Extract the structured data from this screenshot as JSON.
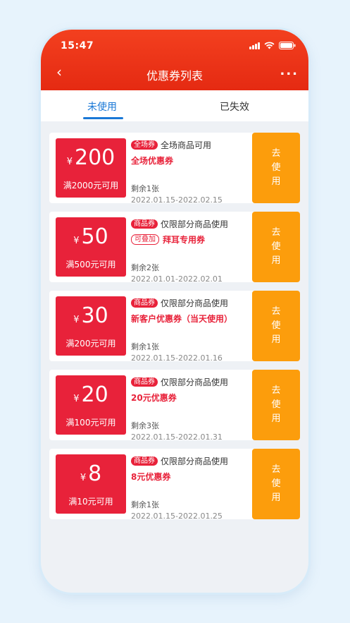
{
  "status_bar": {
    "time": "15:47"
  },
  "nav": {
    "back": "‹",
    "title": "优惠券列表",
    "more": "..."
  },
  "tabs": [
    {
      "label": "未使用",
      "active": true
    },
    {
      "label": "已失效",
      "active": false
    }
  ],
  "coupons": [
    {
      "currency": "¥",
      "amount": "200",
      "threshold": "满2000元可用",
      "tag": "全场券",
      "scope": "全场商品可用",
      "stack_tag": "",
      "name": "全场优惠券",
      "remaining": "剩余1张",
      "dates": "2022.01.15-2022.02.15",
      "button": [
        "去",
        "使",
        "用"
      ]
    },
    {
      "currency": "¥",
      "amount": "50",
      "threshold": "满500元可用",
      "tag": "商品券",
      "scope": "仅限部分商品使用",
      "stack_tag": "可叠加",
      "name": "拜耳专用券",
      "remaining": "剩余2张",
      "dates": "2022.01.01-2022.02.01",
      "button": [
        "去",
        "使",
        "用"
      ]
    },
    {
      "currency": "¥",
      "amount": "30",
      "threshold": "满200元可用",
      "tag": "商品券",
      "scope": "仅限部分商品使用",
      "stack_tag": "",
      "name": "新客户优惠券（当天使用）",
      "remaining": "剩余1张",
      "dates": "2022.01.15-2022.01.16",
      "button": [
        "去",
        "使",
        "用"
      ]
    },
    {
      "currency": "¥",
      "amount": "20",
      "threshold": "满100元可用",
      "tag": "商品券",
      "scope": "仅限部分商品使用",
      "stack_tag": "",
      "name": "20元优惠券",
      "remaining": "剩余3张",
      "dates": "2022.01.15-2022.01.31",
      "button": [
        "去",
        "使",
        "用"
      ]
    },
    {
      "currency": "¥",
      "amount": "8",
      "threshold": "满10元可用",
      "tag": "商品券",
      "scope": "仅限部分商品使用",
      "stack_tag": "",
      "name": "8元优惠券",
      "remaining": "剩余1张",
      "dates": "2022.01.15-2022.01.25",
      "button": [
        "去",
        "使",
        "用"
      ]
    }
  ],
  "colors": {
    "header": "#e52a12",
    "coupon_red": "#e8223a",
    "button_orange": "#fc9d0c",
    "tab_active": "#1a78d6"
  },
  "icons": {
    "signal": "signal-icon",
    "wifi": "wifi-icon",
    "battery": "battery-icon"
  }
}
